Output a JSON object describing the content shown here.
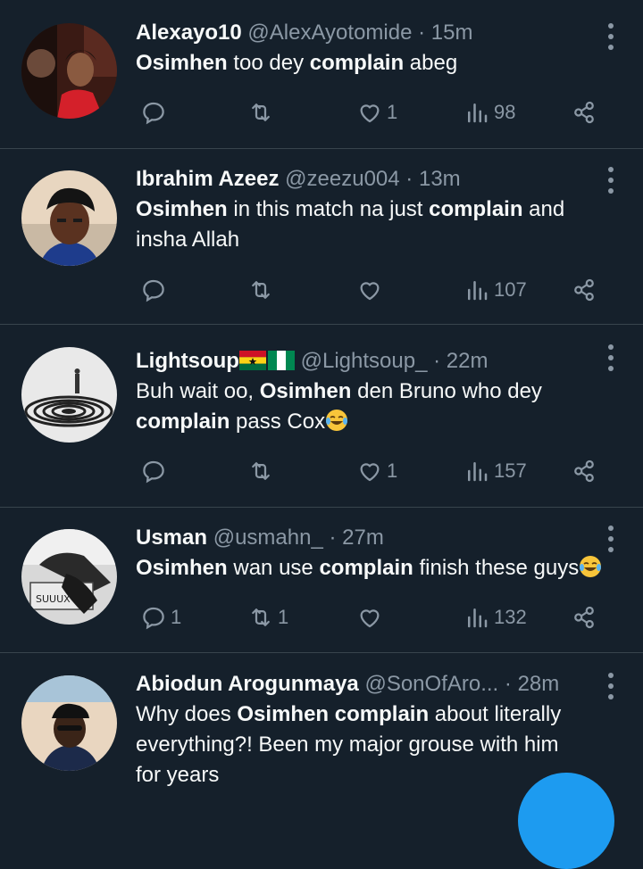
{
  "tweets": [
    {
      "name": "Alexayo10",
      "handle": "@AlexAyotomide",
      "dot": "·",
      "time": "15m",
      "body": [
        {
          "bold": "Osimhen"
        },
        {
          "text": " too dey "
        },
        {
          "bold": "complain"
        },
        {
          "text": " abeg"
        }
      ],
      "replies": "",
      "retweets": "",
      "likes": "1",
      "views": "98"
    },
    {
      "name": "Ibrahim Azeez",
      "handle": "@zeezu004",
      "dot": "·",
      "time": "13m",
      "body": [
        {
          "bold": "Osimhen"
        },
        {
          "text": " in this match na just "
        },
        {
          "bold": "complain"
        },
        {
          "text": " and insha Allah"
        }
      ],
      "replies": "",
      "retweets": "",
      "likes": "",
      "views": "107"
    },
    {
      "name": "Lightsoup",
      "handle": "@Lightsoup_",
      "dot": "·",
      "time": "22m",
      "body": [
        {
          "text": "Buh wait oo, "
        },
        {
          "bold": "Osimhen"
        },
        {
          "text": " den Bruno who dey "
        },
        {
          "bold": "complain"
        },
        {
          "text": " pass Cox"
        }
      ],
      "replies": "",
      "retweets": "",
      "likes": "1",
      "views": "157"
    },
    {
      "name": "Usman",
      "handle": "@usmahn_",
      "dot": "·",
      "time": "27m",
      "body": [
        {
          "bold": "Osimhen"
        },
        {
          "text": " wan use "
        },
        {
          "bold": "complain"
        },
        {
          "text": " finish these guys"
        }
      ],
      "replies": "1",
      "retweets": "1",
      "likes": "",
      "views": "132"
    },
    {
      "name": "Abiodun Arogunmaya",
      "handle": "@SonOfAro...",
      "dot": "·",
      "time": "28m",
      "body": [
        {
          "text": "Why does "
        },
        {
          "bold": "Osimhen"
        },
        {
          "text": " "
        },
        {
          "bold": "complain"
        },
        {
          "text": " about literally everything?! Been my major grouse with him for years"
        }
      ],
      "replies": "",
      "retweets": "",
      "likes": "",
      "views": ""
    }
  ],
  "icons": {
    "reply": "reply-icon",
    "retweet": "retweet-icon",
    "like": "heart-icon",
    "views": "views-icon",
    "share": "share-icon",
    "more": "more-icon",
    "emoji": "tears-of-joy-emoji"
  },
  "colors": {
    "background": "#15202b",
    "divider": "#38444d",
    "secondary_text": "#8b98a5",
    "accent": "#1d9bf0"
  }
}
